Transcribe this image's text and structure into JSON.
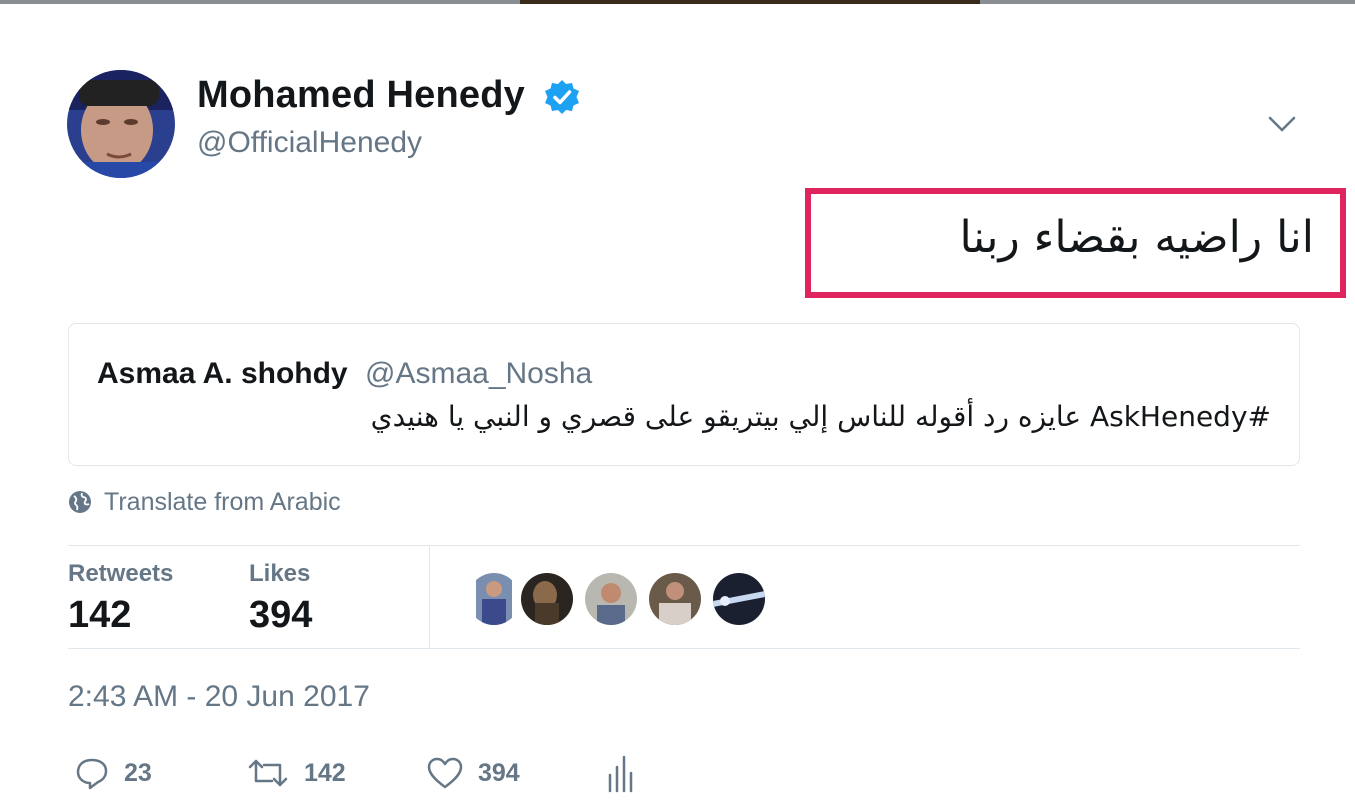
{
  "author": {
    "name": "Mohamed Henedy",
    "handle": "@OfficialHenedy"
  },
  "tweet": {
    "text": "انا راضيه بقضاء ربنا"
  },
  "quoted_tweet": {
    "name": "Asmaa A. shohdy",
    "handle": "@Asmaa_Nosha",
    "text": "#AskHenedy عايزه رد أقوله للناس إلي بيتريقو على قصري و النبي يا هنيدي"
  },
  "translate": {
    "label": "Translate from Arabic"
  },
  "stats": {
    "retweets_label": "Retweets",
    "retweets_value": "142",
    "likes_label": "Likes",
    "likes_value": "394"
  },
  "timestamp": "2:43 AM - 20 Jun 2017",
  "actions": {
    "reply_count": "23",
    "retweet_count": "142",
    "like_count": "394"
  },
  "colors": {
    "highlight_border": "#e0245e",
    "verified": "#1da1f2",
    "secondary_text": "#657786"
  }
}
